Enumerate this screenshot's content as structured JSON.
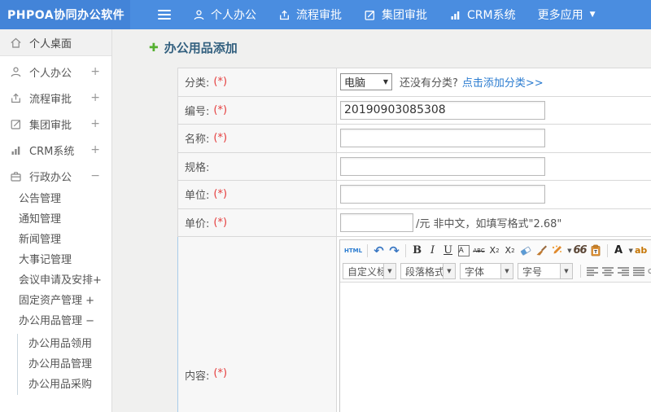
{
  "colors": {
    "navbar_blue": "#4a8de0",
    "brand_blue": "#4384d8",
    "link_blue": "#2b7cd0",
    "title_blue": "#33607f",
    "required_red": "#e53c3c",
    "plus_green": "#55b030"
  },
  "icons": {
    "plus": "✚",
    "undo": "↶",
    "redo": "↷",
    "caret_down": "▼",
    "dd_caret": "▼",
    "select_caret": "▼",
    "paste_t": "T"
  },
  "navbar": {
    "brand": "PHPOA协同办公软件",
    "items": [
      {
        "label": "个人办公",
        "icon": "user-icon"
      },
      {
        "label": "流程审批",
        "icon": "process-icon"
      },
      {
        "label": "集团审批",
        "icon": "edit-icon"
      },
      {
        "label": "CRM系统",
        "icon": "chart-icon"
      },
      {
        "label": "更多应用",
        "icon": "caret-down-icon"
      }
    ]
  },
  "sidebar": {
    "items": [
      {
        "label": "个人桌面",
        "icon": "home-icon",
        "expand": ""
      },
      {
        "label": "个人办公",
        "icon": "user-icon",
        "expand": "+"
      },
      {
        "label": "流程审批",
        "icon": "process-icon",
        "expand": "+"
      },
      {
        "label": "集团审批",
        "icon": "edit-icon",
        "expand": "+"
      },
      {
        "label": "CRM系统",
        "icon": "chart-icon",
        "expand": "+"
      },
      {
        "label": "行政办公",
        "icon": "briefcase-icon",
        "expand": "−"
      }
    ],
    "subitems": [
      "公告管理",
      "通知管理",
      "新闻管理",
      "大事记管理",
      "会议申请及安排+",
      "固定资产管理 +",
      "办公用品管理 −"
    ],
    "subsubitems": [
      "办公用品领用",
      "办公用品管理",
      "办公用品采购"
    ]
  },
  "main": {
    "title": "办公用品添加",
    "form": {
      "category": {
        "label": "分类:",
        "required": "(*)",
        "select_value": "电脑",
        "hint_plain": "还没有分类?",
        "hint_link": "点击添加分类>>"
      },
      "code": {
        "label": "编号:",
        "required": "(*)",
        "value": "20190903085308"
      },
      "name": {
        "label": "名称:",
        "required": "(*)"
      },
      "spec": {
        "label": "规格:"
      },
      "unit": {
        "label": "单位:",
        "required": "(*)"
      },
      "price": {
        "label": "单价:",
        "required": "(*)",
        "hint": "/元 非中文，如填写格式\"2.68\""
      },
      "content": {
        "label": "内容:",
        "required": "(*)"
      }
    },
    "editor": {
      "html_btn": "HTML",
      "bold": "B",
      "italic": "I",
      "underline": "U",
      "abox_label": "A",
      "strike_label": "ABC",
      "sup_base": "X",
      "sup_exp": "2",
      "sub_base": "X",
      "sub_exp": "2",
      "quote_label": "66",
      "fontcolor_label": "A",
      "highlight_label": "ab",
      "dropdowns": [
        "自定义标题",
        "段落格式",
        "字体",
        "字号"
      ]
    }
  }
}
